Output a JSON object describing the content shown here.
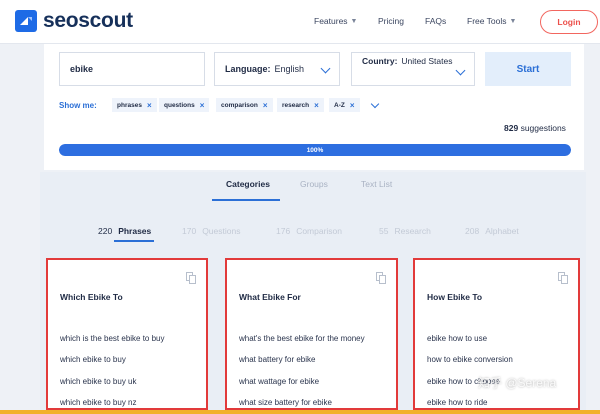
{
  "header": {
    "logo_text": "seoscout",
    "nav": [
      "Features",
      "Pricing",
      "FAQs",
      "Free Tools"
    ],
    "login": "Login"
  },
  "search": {
    "keyword": "ebike",
    "language_label": "Language:",
    "language_value": "English",
    "country_label": "Country:",
    "country_value": "United States",
    "start": "Start",
    "showme_label": "Show me:",
    "chips": [
      "phrases",
      "questions",
      "comparison",
      "research",
      "A-Z"
    ],
    "suggestions_count": "829",
    "suggestions_label": "suggestions",
    "progress_text": "100%",
    "progress_value": 100
  },
  "tabs": [
    "Categories",
    "Groups",
    "Text List"
  ],
  "subtabs": [
    {
      "count": "220",
      "label": "Phrases"
    },
    {
      "count": "170",
      "label": "Questions"
    },
    {
      "count": "176",
      "label": "Comparison"
    },
    {
      "count": "55",
      "label": "Research"
    },
    {
      "count": "208",
      "label": "Alphabet"
    }
  ],
  "cards": [
    {
      "title": "Which Ebike To",
      "items": [
        "which is the best ebike to buy",
        "which ebike to buy",
        "which ebike to buy uk",
        "which ebike to buy nz"
      ]
    },
    {
      "title": "What Ebike For",
      "items": [
        "what's the best ebike for the money",
        "what battery for ebike",
        "what wattage for ebike",
        "what size battery for ebike"
      ]
    },
    {
      "title": "How Ebike To",
      "items": [
        "ebike how to use",
        "how to ebike conversion",
        "ebike how to choose",
        "ebike how to ride"
      ]
    }
  ],
  "watermark": "知乎 @Serena",
  "colors": {
    "accent": "#2b6fd6",
    "login": "#ec4f4a",
    "card_border": "#e23a3a"
  }
}
